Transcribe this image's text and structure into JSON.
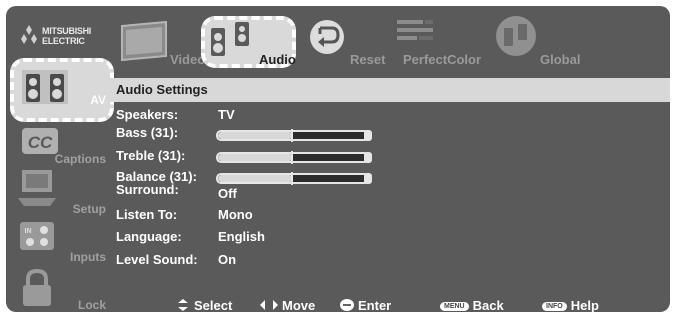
{
  "brand": {
    "line1": "MITSUBISHI",
    "line2": "ELECTRIC"
  },
  "top_tabs": [
    {
      "label": "Video",
      "icon": "video-tv-icon",
      "selected": false
    },
    {
      "label": "Audio",
      "icon": "speakers-icon",
      "selected": true
    },
    {
      "label": "Reset",
      "icon": "reset-arrow-icon",
      "selected": false
    },
    {
      "label": "PerfectColor",
      "icon": "color-bars-icon",
      "selected": false
    },
    {
      "label": "Global",
      "icon": "globe-speakers-icon",
      "selected": false
    }
  ],
  "side_menu": [
    {
      "label": "AV",
      "icon": "speakers-icon",
      "selected": true
    },
    {
      "label": "Captions",
      "icon": "cc-icon",
      "selected": false
    },
    {
      "label": "Setup",
      "icon": "setup-tv-icon",
      "selected": false
    },
    {
      "label": "Inputs",
      "icon": "inputs-jack-icon",
      "selected": false
    },
    {
      "label": "Lock",
      "icon": "padlock-icon",
      "selected": false
    }
  ],
  "section_title": "Audio Settings",
  "settings": [
    {
      "label": "Speakers:",
      "value": "TV"
    },
    {
      "label": "Bass (31):",
      "slider": 0.5
    },
    {
      "label": "Treble (31):",
      "slider": 0.5
    },
    {
      "label": "Balance (31):",
      "slider": 0.5
    },
    {
      "label": "Surround:",
      "value": "Off"
    },
    {
      "label": "Listen To:",
      "value": "Mono"
    },
    {
      "label": "Language:",
      "value": "English"
    },
    {
      "label": "Level Sound:",
      "value": "On"
    }
  ],
  "footer": {
    "select": "Select",
    "move": "Move",
    "enter": "Enter",
    "back_key": "MENU",
    "back": "Back",
    "help_key": "INFO",
    "help": "Help"
  },
  "colors": {
    "background": "#5a5a5a",
    "highlight": "#d9d9d9",
    "text": "#ffffff",
    "inactive_text": "#9a9a9a"
  }
}
